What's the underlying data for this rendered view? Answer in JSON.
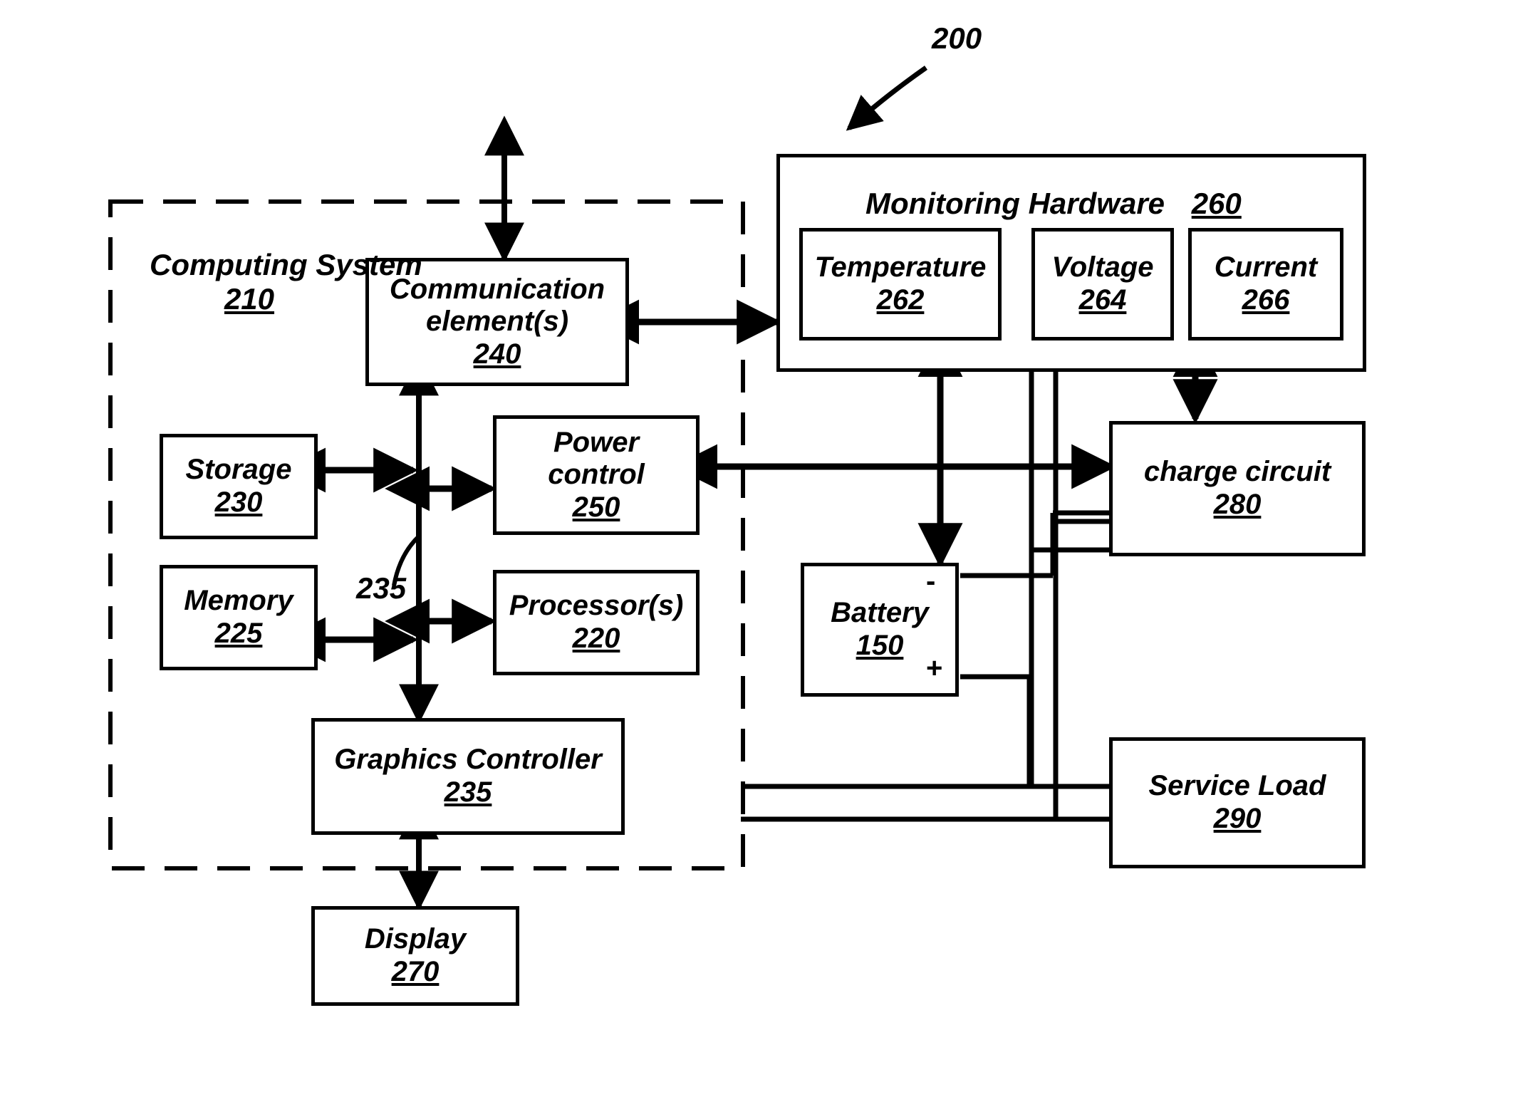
{
  "figure": {
    "number": "200",
    "bus_label": "235",
    "battery_minus": "-",
    "battery_plus": "+"
  },
  "boundary": {
    "name": "computing-system-dashed-boundary"
  },
  "computing_system": {
    "title_line1": "Computing",
    "title_line2": "System",
    "ref": "210"
  },
  "nodes": [
    {
      "id": "communication-elements",
      "title_line1": "Communication",
      "title_line2": "element(s)",
      "ref": "240"
    },
    {
      "id": "storage",
      "title_line1": "Storage",
      "title_line2": "",
      "ref": "230"
    },
    {
      "id": "memory",
      "title_line1": "Memory",
      "title_line2": "",
      "ref": "225"
    },
    {
      "id": "power-control",
      "title_line1": "Power",
      "title_line2": "control",
      "ref": "250"
    },
    {
      "id": "processors",
      "title_line1": "Processor(s)",
      "title_line2": "",
      "ref": "220"
    },
    {
      "id": "graphics-controller",
      "title_line1": "Graphics Controller",
      "title_line2": "",
      "ref": "235"
    },
    {
      "id": "display",
      "title_line1": "Display",
      "title_line2": "",
      "ref": "270"
    },
    {
      "id": "monitoring-hardware",
      "title_line1": "Monitoring Hardware",
      "title_line2": "",
      "ref": "260"
    },
    {
      "id": "temperature",
      "title_line1": "Temperature",
      "title_line2": "",
      "ref": "262"
    },
    {
      "id": "voltage",
      "title_line1": "Voltage",
      "title_line2": "",
      "ref": "264"
    },
    {
      "id": "current",
      "title_line1": "Current",
      "title_line2": "",
      "ref": "266"
    },
    {
      "id": "charge-circuit",
      "title_line1": "charge circuit",
      "title_line2": "",
      "ref": "280"
    },
    {
      "id": "battery",
      "title_line1": "Battery",
      "title_line2": "",
      "ref": "150"
    },
    {
      "id": "service-load",
      "title_line1": "Service Load",
      "title_line2": "",
      "ref": "290"
    }
  ],
  "colors": {
    "ink": "#000000",
    "paper": "#ffffff"
  }
}
